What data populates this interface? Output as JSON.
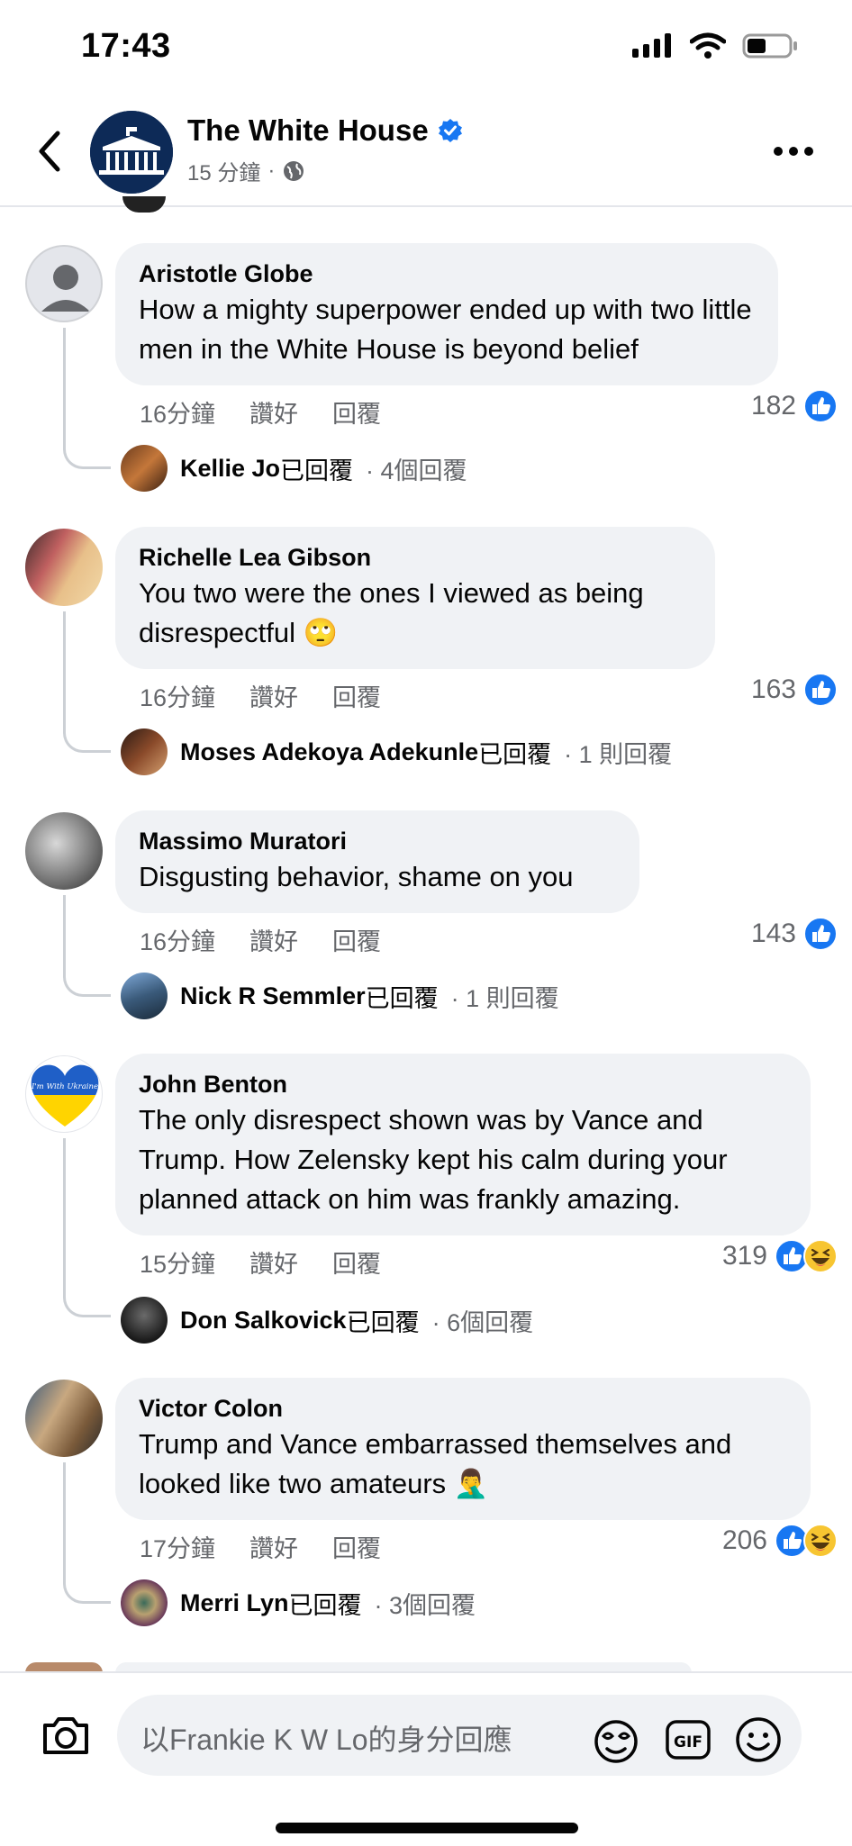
{
  "status_bar": {
    "time": "17:43"
  },
  "header": {
    "page_name": "The White House",
    "time_ago": "15 分鐘",
    "separator": "·"
  },
  "actions": {
    "like": "讚好",
    "reply": "回覆"
  },
  "composer": {
    "placeholder": "以Frankie K W Lo的身分回應"
  },
  "comments": [
    {
      "author": "Aristotle Globe",
      "text": "How a mighty superpower ended up with two little men in the White House is beyond belief",
      "time": "16分鐘",
      "reaction_count": "182",
      "reply": {
        "name": "Kellie Jo",
        "verb": "已回覆",
        "count": "· 4個回覆"
      }
    },
    {
      "author": "Richelle Lea Gibson",
      "text": "You two were the ones I viewed as being disrespectful 🙄",
      "time": "16分鐘",
      "reaction_count": "163",
      "reply": {
        "name": "Moses Adekoya Adekunle",
        "verb": "已回覆",
        "count": "· 1 則回覆"
      }
    },
    {
      "author": "Massimo Muratori",
      "text": "Disgusting behavior, shame on you",
      "time": "16分鐘",
      "reaction_count": "143",
      "reply": {
        "name": "Nick R Semmler",
        "verb": "已回覆",
        "count": "· 1 則回覆"
      }
    },
    {
      "author": "John Benton",
      "text": "The only disrespect shown was by Vance and Trump. How Zelensky kept his calm during your planned attack on him was frankly amazing.",
      "time": "15分鐘",
      "reaction_count": "319",
      "avatar_text": "I'm With Ukraine",
      "reply": {
        "name": "Don Salkovick",
        "verb": "已回覆",
        "count": "· 6個回覆"
      }
    },
    {
      "author": "Victor Colon",
      "text": "Trump and Vance embarrassed themselves and looked like two amateurs 🤦‍♂️",
      "time": "17分鐘",
      "reaction_count": "206",
      "reply": {
        "name": "Merri Lyn",
        "verb": "已回覆",
        "count": "· 3個回覆"
      }
    }
  ],
  "colors": {
    "accent": "#1877f2",
    "bubble": "#f0f2f5",
    "muted": "#65676b"
  }
}
